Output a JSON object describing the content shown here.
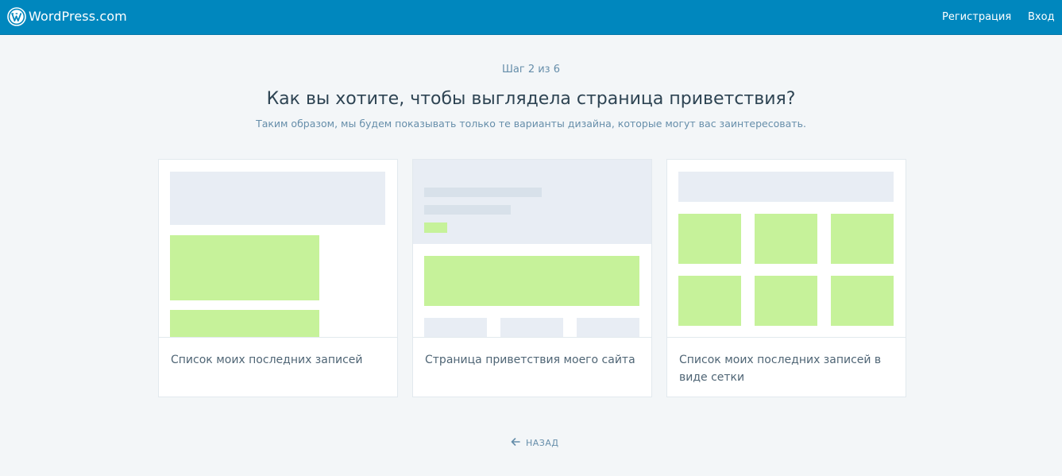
{
  "header": {
    "brand": "WordPress.com",
    "signup": "Регистрация",
    "login": "Вход"
  },
  "main": {
    "step": "Шаг 2 из 6",
    "headline": "Как вы хотите, чтобы выглядела страница приветствия?",
    "subheadline": "Таким образом, мы будем показывать только те варианты дизайна, которые могут вас заинтересовать.",
    "options": [
      {
        "label": "Список моих последних записей"
      },
      {
        "label": "Страница приветствия моего сайта"
      },
      {
        "label": "Список моих последних записей в виде сетки"
      }
    ],
    "back": "НАЗАД"
  },
  "colors": {
    "header_bg": "#0087be",
    "page_bg": "#f3f6f8",
    "placeholder_gray": "#e8edf4",
    "placeholder_green": "#c6f29a"
  },
  "icons": {
    "brand": "wordpress-logo-icon",
    "back": "arrow-left-icon"
  }
}
